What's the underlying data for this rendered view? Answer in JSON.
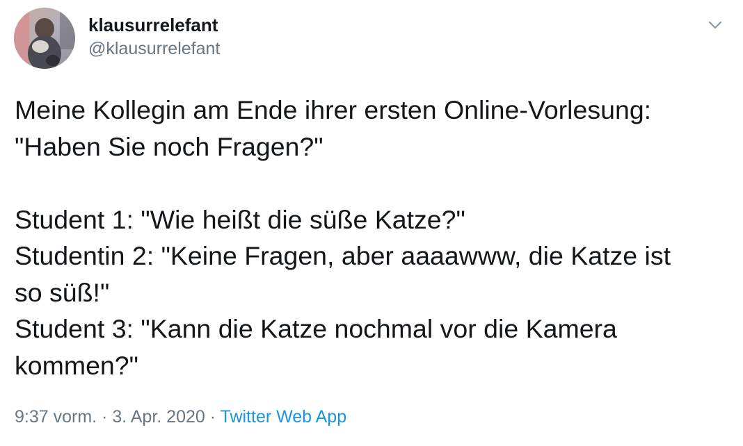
{
  "author": {
    "display_name": "klausurrelefant",
    "handle": "@klausurrelefant",
    "avatar_icon": "profile-photo"
  },
  "menu": {
    "icon": "chevron-down-icon",
    "color": "#8899a6"
  },
  "tweet": {
    "lines": [
      "Meine Kollegin am Ende ihrer ersten Online-Vorlesung:",
      "\"Haben Sie noch Fragen?\"",
      "",
      "Student 1: \"Wie heißt die süße Katze?\"",
      "Studentin 2: \"Keine Fragen, aber aaaawww, die Katze ist",
      "so süß!\"",
      "Student 3: \"Kann die Katze nochmal vor die Kamera",
      "kommen?\""
    ]
  },
  "meta": {
    "time": "9:37 vorm.",
    "separator": " · ",
    "date": "3. Apr. 2020",
    "source": "Twitter Web App"
  },
  "colors": {
    "text": "#14171a",
    "secondary": "#657786",
    "link": "#1b95e0"
  }
}
